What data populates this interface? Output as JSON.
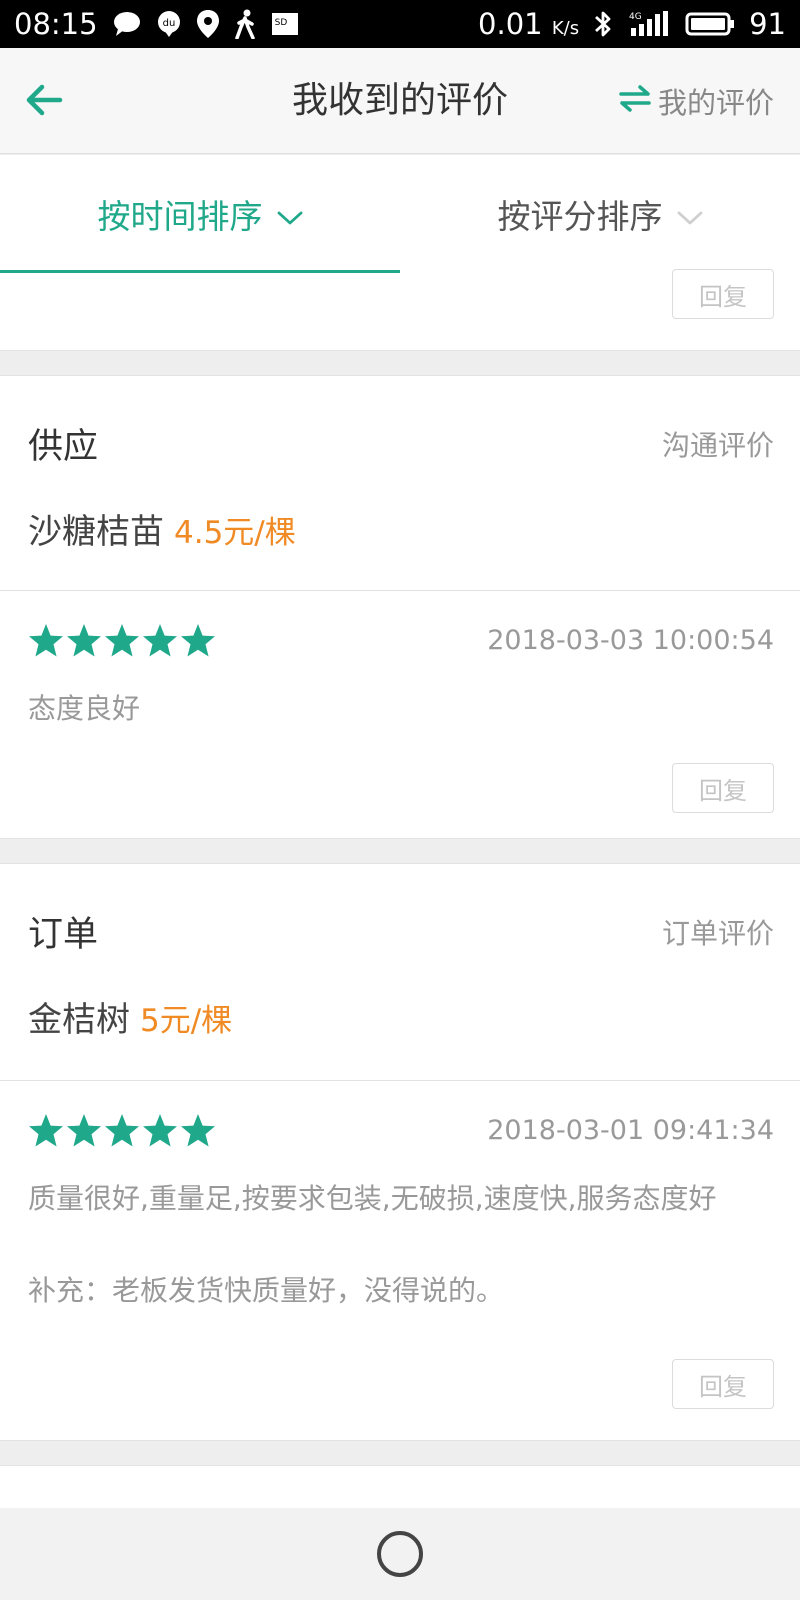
{
  "status_bar": {
    "time": "08:15",
    "net_speed": "0.01",
    "net_unit": "K/s",
    "battery": "91",
    "icons_left": [
      "message-icon",
      "du-icon",
      "location-icon",
      "walk-icon",
      "sd-card-icon"
    ],
    "icons_right": [
      "bluetooth-icon",
      "signal-4g-icon",
      "battery-icon"
    ]
  },
  "nav": {
    "back_icon": "arrow-left-icon",
    "title": "我收到的评价",
    "my_reviews_icon": "swap-icon",
    "my_reviews_label": "我的评价"
  },
  "tabs": [
    {
      "label": "按时间排序",
      "active": true
    },
    {
      "label": "按评分排序",
      "active": false
    }
  ],
  "reply_label": "回复",
  "reviews": [
    {
      "kind": "供应",
      "kind_type": "沟通评价",
      "product": "沙糖桔苗",
      "price": "4.5元/棵",
      "rating": 5,
      "time": "2018-03-03 10:00:54",
      "comment": "态度良好",
      "supplement": ""
    },
    {
      "kind": "订单",
      "kind_type": "订单评价",
      "product": "金桔树",
      "price": "5元/棵",
      "rating": 5,
      "time": "2018-03-01 09:41:34",
      "comment": "质量很好,重量足,按要求包装,无破损,速度快,服务态度好",
      "supplement": "补充：老板发货快质量好，没得说的。"
    }
  ],
  "colors": {
    "accent": "#20a88a",
    "price": "#f08a24",
    "muted": "#999999"
  }
}
